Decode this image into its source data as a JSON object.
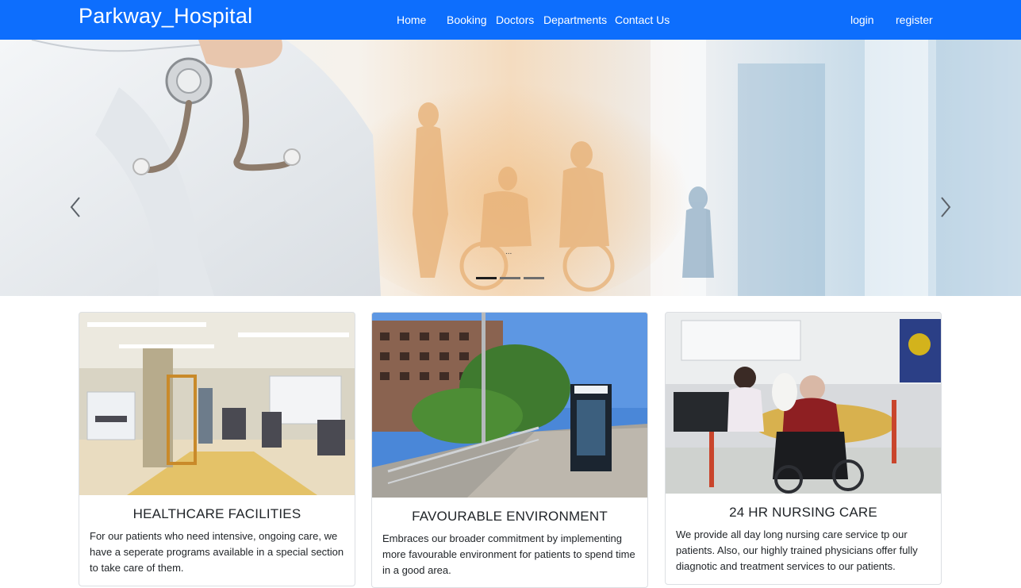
{
  "navbar": {
    "brand": "Parkway_Hospital",
    "links": [
      "Home",
      "Booking",
      "Doctors",
      "Departments",
      "Contact Us"
    ],
    "auth": [
      "login",
      "register"
    ]
  },
  "carousel": {
    "caption": "...",
    "active_slide": 1,
    "slide_count": 3,
    "prev_icon": "chevron-left-icon",
    "next_icon": "chevron-right-icon"
  },
  "cards": [
    {
      "title": "HEALTHCARE FACILITIES",
      "text": "For our patients who need intensive, ongoing care, we have a seperate programs available in a special section to take care of them."
    },
    {
      "title": "FAVOURABLE ENVIRONMENT",
      "text": "Embraces our broader commitment by implementing more favourable environment for patients to spend time in a good area."
    },
    {
      "title": "24 HR NURSING CARE",
      "text": "We provide all day long nursing care service tp our patients. Also, our highly trained physicians offer fully diagnotic and treatment services to our patients."
    }
  ],
  "colors": {
    "primary": "#0d6efd",
    "text": "#212529"
  }
}
